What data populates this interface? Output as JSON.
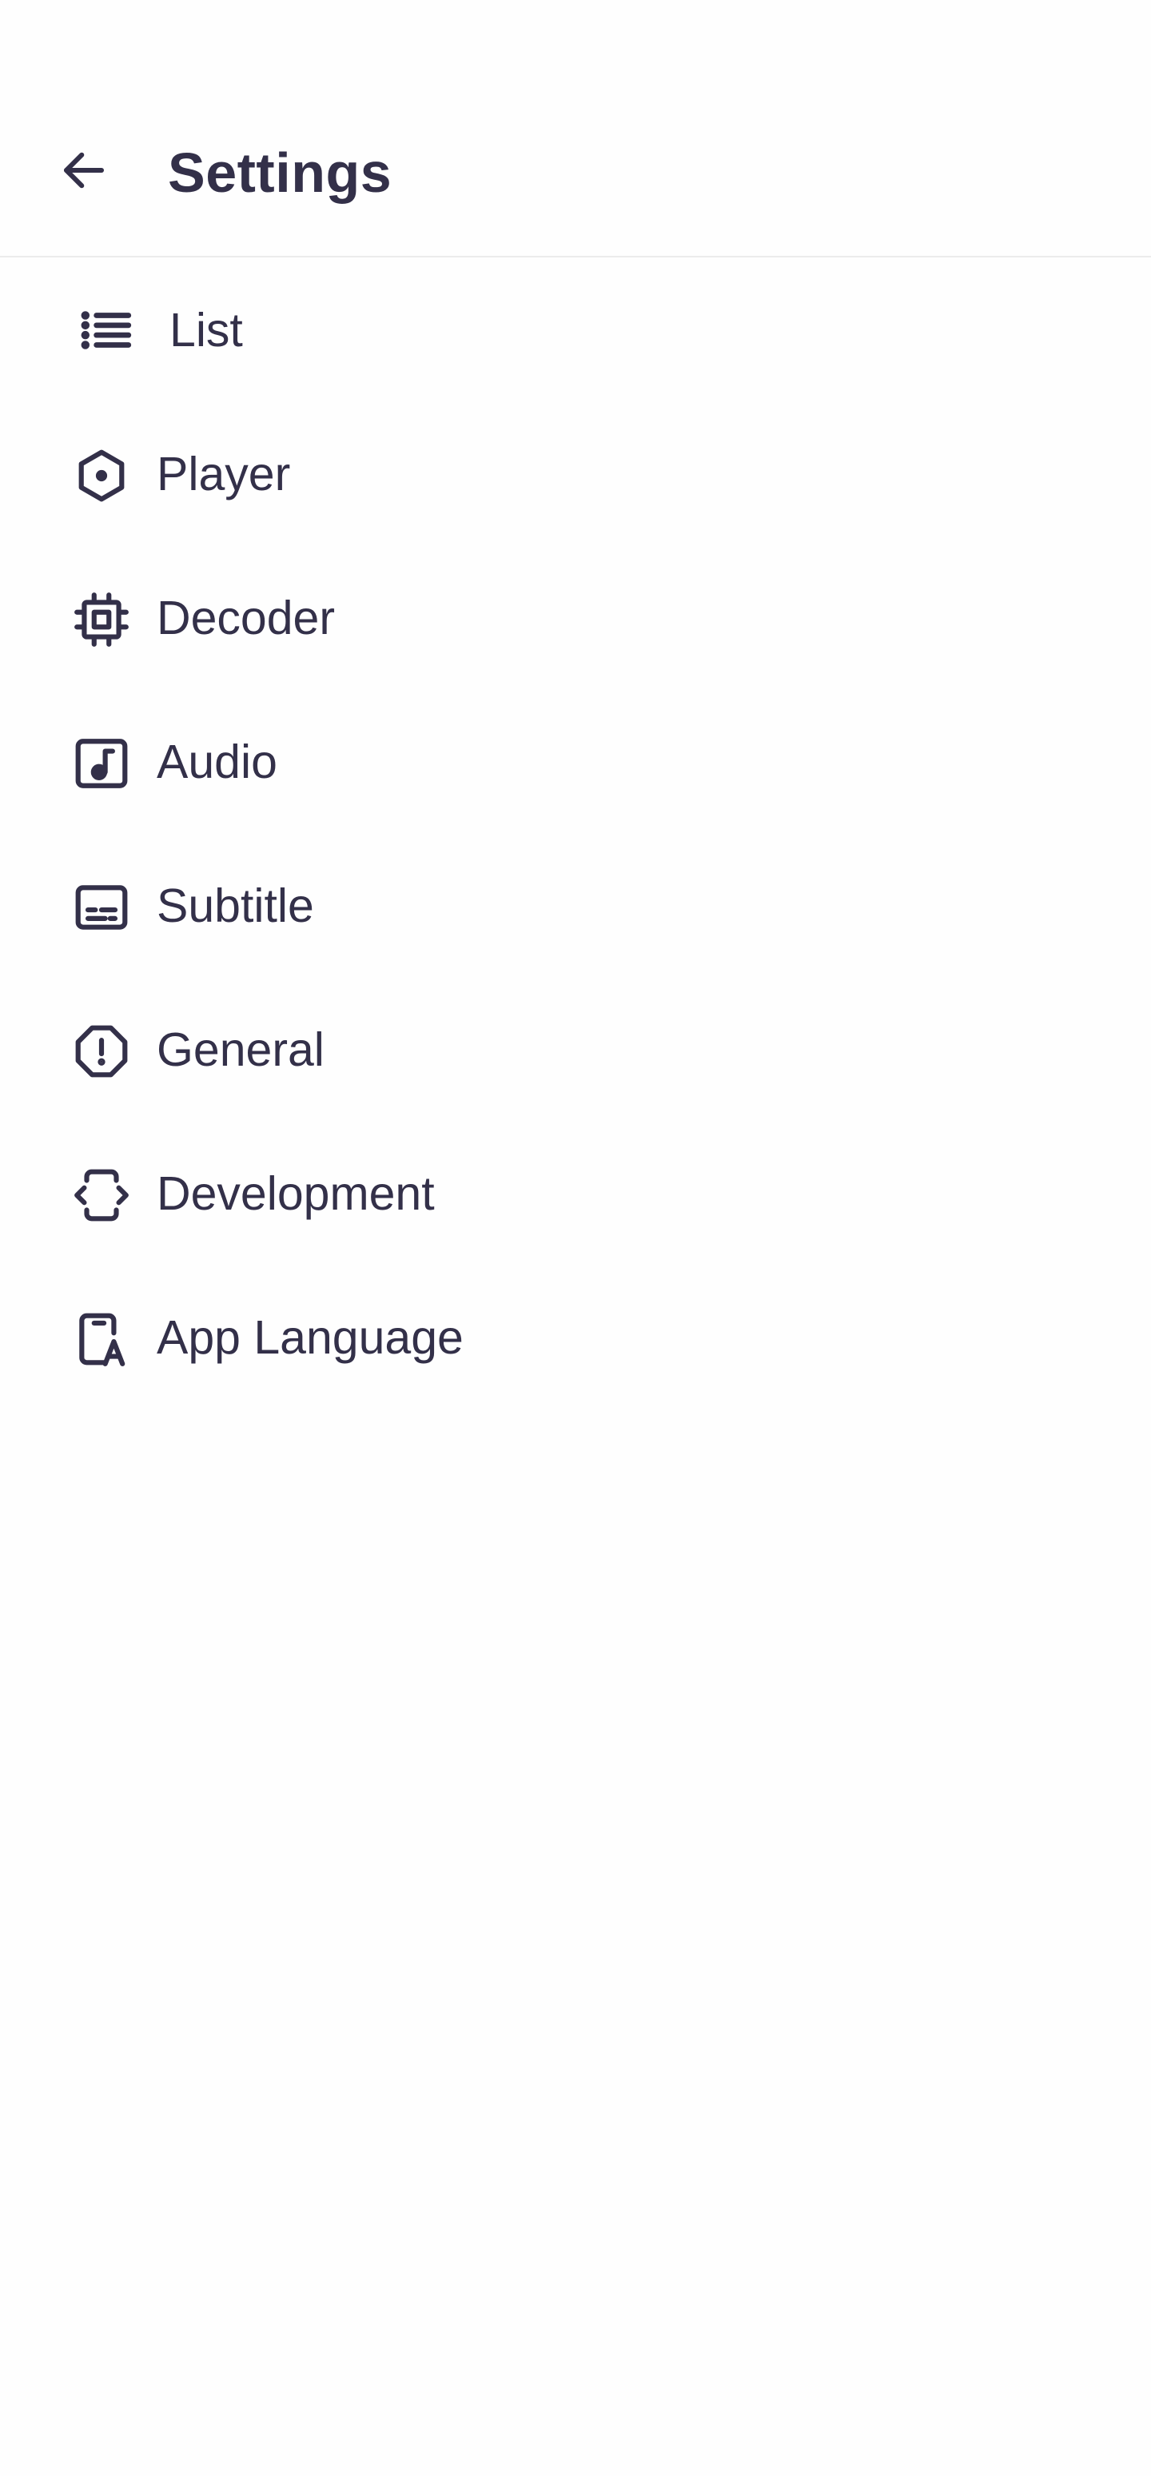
{
  "header": {
    "back_icon": "arrow-left-icon",
    "title": "Settings"
  },
  "settings": {
    "items": [
      {
        "id": "list",
        "label": "List",
        "icon": "list-icon"
      },
      {
        "id": "player",
        "label": "Player",
        "icon": "hexagon-dot-icon"
      },
      {
        "id": "decoder",
        "label": "Decoder",
        "icon": "cpu-chip-icon"
      },
      {
        "id": "audio",
        "label": "Audio",
        "icon": "music-note-box-icon"
      },
      {
        "id": "subtitle",
        "label": "Subtitle",
        "icon": "subtitles-icon"
      },
      {
        "id": "general",
        "label": "General",
        "icon": "octagon-alert-icon"
      },
      {
        "id": "development",
        "label": "Development",
        "icon": "code-device-icon"
      },
      {
        "id": "app-language",
        "label": "App Language",
        "icon": "translate-device-icon"
      }
    ]
  },
  "colors": {
    "text": "#333049",
    "background": "#fefefe",
    "divider": "#ececec"
  }
}
